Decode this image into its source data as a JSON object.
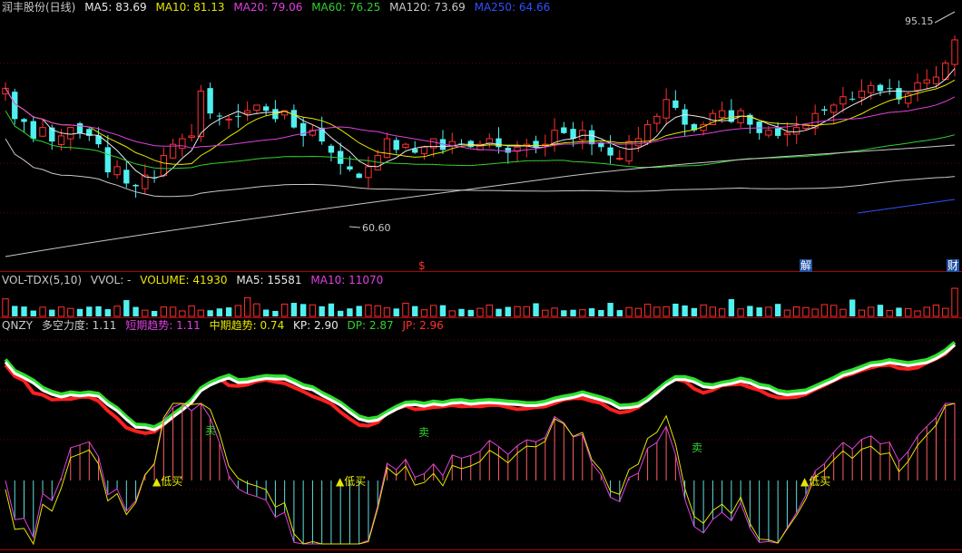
{
  "main_header": {
    "title": "润丰股份(日线)",
    "ma": [
      {
        "label": "MA5: 83.69",
        "color": "#e8e8e8"
      },
      {
        "label": "MA10: 81.13",
        "color": "#e6e600"
      },
      {
        "label": "MA20: 79.06",
        "color": "#e040e0"
      },
      {
        "label": "MA60: 76.25",
        "color": "#30d030"
      },
      {
        "label": "MA120: 73.69",
        "color": "#c8c8c8"
      },
      {
        "label": "MA250: 64.66",
        "color": "#3050ff"
      }
    ]
  },
  "price_labels": {
    "high": "95.15",
    "low": "60.60"
  },
  "event_marks": [
    {
      "text": "$",
      "color": "#ff3030"
    },
    {
      "text": "解",
      "color": "#ffffff",
      "bg": "#2050a0"
    },
    {
      "text": "财",
      "color": "#ffffff",
      "bg": "#2050a0"
    }
  ],
  "vol_header": {
    "name": "VOL-TDX(5,10)",
    "vvol": "VVOL: -",
    "volume": "VOLUME: 41930",
    "ma5": "MA5: 15581",
    "ma10": "MA10: 11070"
  },
  "ind_header": {
    "name": "QNZY",
    "f1": "多空力度: 1.11",
    "f2": "短期趋势: 1.11",
    "f3": "中期趋势: 0.74",
    "f4": "KP: 2.90",
    "f5": "DP: 2.87",
    "f6": "JP: 2.96"
  },
  "signals": {
    "buy": "▲低买",
    "sell": "卖"
  },
  "colors": {
    "up": "#ff3030",
    "down": "#50f0f0",
    "bg": "#000000"
  },
  "chart_data": {
    "type": "candlestick",
    "close": [
      86.5,
      81.0,
      80.5,
      77.5,
      79.5,
      77.0,
      78.0,
      79.5,
      78.5,
      78.0,
      76.5,
      71.5,
      72.5,
      69.5,
      69.0,
      71.0,
      70.5,
      74.5,
      76.5,
      77.5,
      78.0,
      86.0,
      82.0,
      81.5,
      81.0,
      81.5,
      82.5,
      83.5,
      82.5,
      81.0,
      82.5,
      79.5,
      78.0,
      79.0,
      77.0,
      75.0,
      73.0,
      72.0,
      70.5,
      72.5,
      74.5,
      77.5,
      75.5,
      76.5,
      75.0,
      76.0,
      77.5,
      75.5,
      77.0,
      76.5,
      76.0,
      76.5,
      77.5,
      76.0,
      75.0,
      76.0,
      76.5,
      76.0,
      76.5,
      79.0,
      78.5,
      77.5,
      79.0,
      76.5,
      76.0,
      74.5,
      74.0,
      77.0,
      77.5,
      80.0,
      81.5,
      84.5,
      83.0,
      80.0,
      79.0,
      80.0,
      82.0,
      82.5,
      80.5,
      82.5,
      80.0,
      78.5,
      79.0,
      78.0,
      78.5,
      79.5,
      80.0,
      82.0,
      82.5,
      83.5,
      85.0,
      84.5,
      86.0,
      87.0,
      86.0,
      86.5,
      84.5,
      85.5,
      87.5,
      88.0,
      88.5,
      91.0,
      95.15
    ],
    "ylim": [
      55,
      100
    ],
    "volume_last": 41930
  }
}
